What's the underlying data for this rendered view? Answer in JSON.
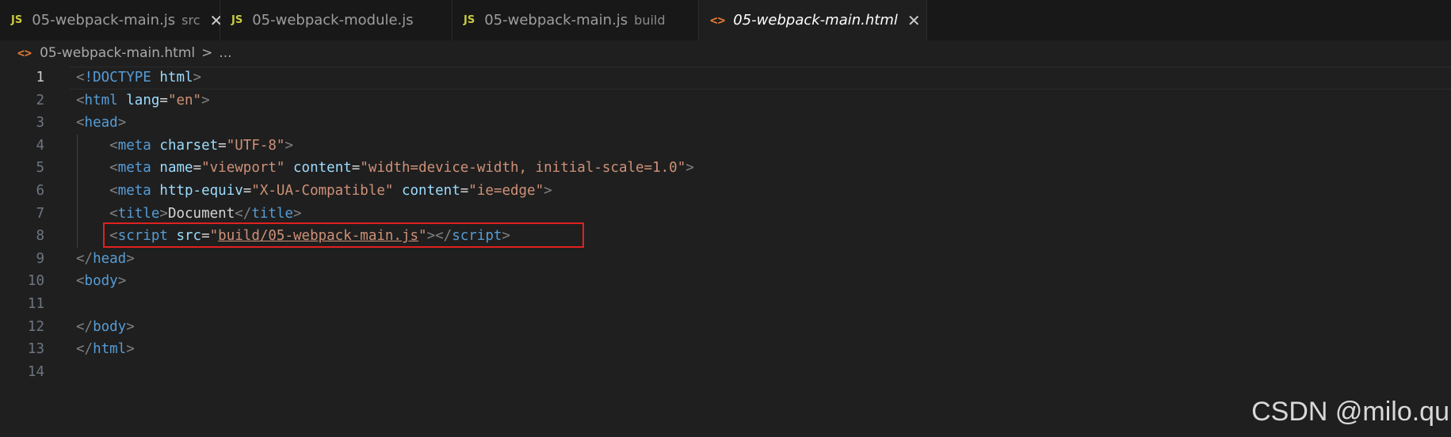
{
  "tabs": [
    {
      "icon": "JS",
      "label": "05-webpack-main.js",
      "desc": "src",
      "close": "✕",
      "active": false
    },
    {
      "icon": "JS",
      "label": "05-webpack-module.js",
      "desc": "",
      "close": "",
      "active": false
    },
    {
      "icon": "JS",
      "label": "05-webpack-main.js",
      "desc": "build",
      "close": "",
      "active": false
    },
    {
      "icon": "<>",
      "label": "05-webpack-main.html",
      "desc": "",
      "close": "✕",
      "active": true
    }
  ],
  "breadcrumb": {
    "icon": "<>",
    "file": "05-webpack-main.html",
    "separator": ">",
    "more": "..."
  },
  "editor": {
    "current_line": 1,
    "lines": [
      {
        "n": "1",
        "tokens": [
          [
            "t-br",
            "<"
          ],
          [
            "t-doctype",
            "!DOCTYPE"
          ],
          [
            "t-txt",
            " "
          ],
          [
            "t-dtname",
            "html"
          ],
          [
            "t-br",
            ">"
          ]
        ]
      },
      {
        "n": "2",
        "tokens": [
          [
            "t-br",
            "<"
          ],
          [
            "t-tag",
            "html"
          ],
          [
            "t-txt",
            " "
          ],
          [
            "t-attr",
            "lang"
          ],
          [
            "t-txt",
            "="
          ],
          [
            "t-str",
            "\"en\""
          ],
          [
            "t-br",
            ">"
          ]
        ]
      },
      {
        "n": "3",
        "tokens": [
          [
            "t-br",
            "<"
          ],
          [
            "t-tag",
            "head"
          ],
          [
            "t-br",
            ">"
          ]
        ]
      },
      {
        "n": "4",
        "indent": true,
        "tokens": [
          [
            "t-txt",
            "    "
          ],
          [
            "t-br",
            "<"
          ],
          [
            "t-tag",
            "meta"
          ],
          [
            "t-txt",
            " "
          ],
          [
            "t-attr",
            "charset"
          ],
          [
            "t-txt",
            "="
          ],
          [
            "t-str",
            "\"UTF-8\""
          ],
          [
            "t-br",
            ">"
          ]
        ]
      },
      {
        "n": "5",
        "indent": true,
        "tokens": [
          [
            "t-txt",
            "    "
          ],
          [
            "t-br",
            "<"
          ],
          [
            "t-tag",
            "meta"
          ],
          [
            "t-txt",
            " "
          ],
          [
            "t-attr",
            "name"
          ],
          [
            "t-txt",
            "="
          ],
          [
            "t-str",
            "\"viewport\""
          ],
          [
            "t-txt",
            " "
          ],
          [
            "t-attr",
            "content"
          ],
          [
            "t-txt",
            "="
          ],
          [
            "t-str",
            "\"width=device-width, initial-scale=1.0\""
          ],
          [
            "t-br",
            ">"
          ]
        ]
      },
      {
        "n": "6",
        "indent": true,
        "tokens": [
          [
            "t-txt",
            "    "
          ],
          [
            "t-br",
            "<"
          ],
          [
            "t-tag",
            "meta"
          ],
          [
            "t-txt",
            " "
          ],
          [
            "t-attr",
            "http-equiv"
          ],
          [
            "t-txt",
            "="
          ],
          [
            "t-str",
            "\"X-UA-Compatible\""
          ],
          [
            "t-txt",
            " "
          ],
          [
            "t-attr",
            "content"
          ],
          [
            "t-txt",
            "="
          ],
          [
            "t-str",
            "\"ie=edge\""
          ],
          [
            "t-br",
            ">"
          ]
        ]
      },
      {
        "n": "7",
        "indent": true,
        "tokens": [
          [
            "t-txt",
            "    "
          ],
          [
            "t-br",
            "<"
          ],
          [
            "t-tag",
            "title"
          ],
          [
            "t-br",
            ">"
          ],
          [
            "t-txt",
            "Document"
          ],
          [
            "t-br",
            "</"
          ],
          [
            "t-tag",
            "title"
          ],
          [
            "t-br",
            ">"
          ]
        ]
      },
      {
        "n": "8",
        "indent": true,
        "tokens": [
          [
            "t-txt",
            "    "
          ],
          [
            "t-br",
            "<"
          ],
          [
            "t-tag",
            "script"
          ],
          [
            "t-txt",
            " "
          ],
          [
            "t-attr",
            "src"
          ],
          [
            "t-txt",
            "="
          ],
          [
            "t-str",
            "\""
          ],
          [
            "t-str t-link",
            "build/05-webpack-main.js"
          ],
          [
            "t-str",
            "\""
          ],
          [
            "t-br",
            "></"
          ],
          [
            "t-tag",
            "script"
          ],
          [
            "t-br",
            ">"
          ]
        ]
      },
      {
        "n": "9",
        "tokens": [
          [
            "t-br",
            "</"
          ],
          [
            "t-tag",
            "head"
          ],
          [
            "t-br",
            ">"
          ]
        ]
      },
      {
        "n": "10",
        "tokens": [
          [
            "t-br",
            "<"
          ],
          [
            "t-tag",
            "body"
          ],
          [
            "t-br",
            ">"
          ]
        ]
      },
      {
        "n": "11",
        "tokens": []
      },
      {
        "n": "12",
        "tokens": [
          [
            "t-br",
            "</"
          ],
          [
            "t-tag",
            "body"
          ],
          [
            "t-br",
            ">"
          ]
        ]
      },
      {
        "n": "13",
        "tokens": [
          [
            "t-br",
            "</"
          ],
          [
            "t-tag",
            "html"
          ],
          [
            "t-br",
            ">"
          ]
        ]
      },
      {
        "n": "14",
        "tokens": []
      }
    ]
  },
  "annotation": {
    "color": "#e02020",
    "target_line": 8
  },
  "watermark": "CSDN @milo.qu"
}
